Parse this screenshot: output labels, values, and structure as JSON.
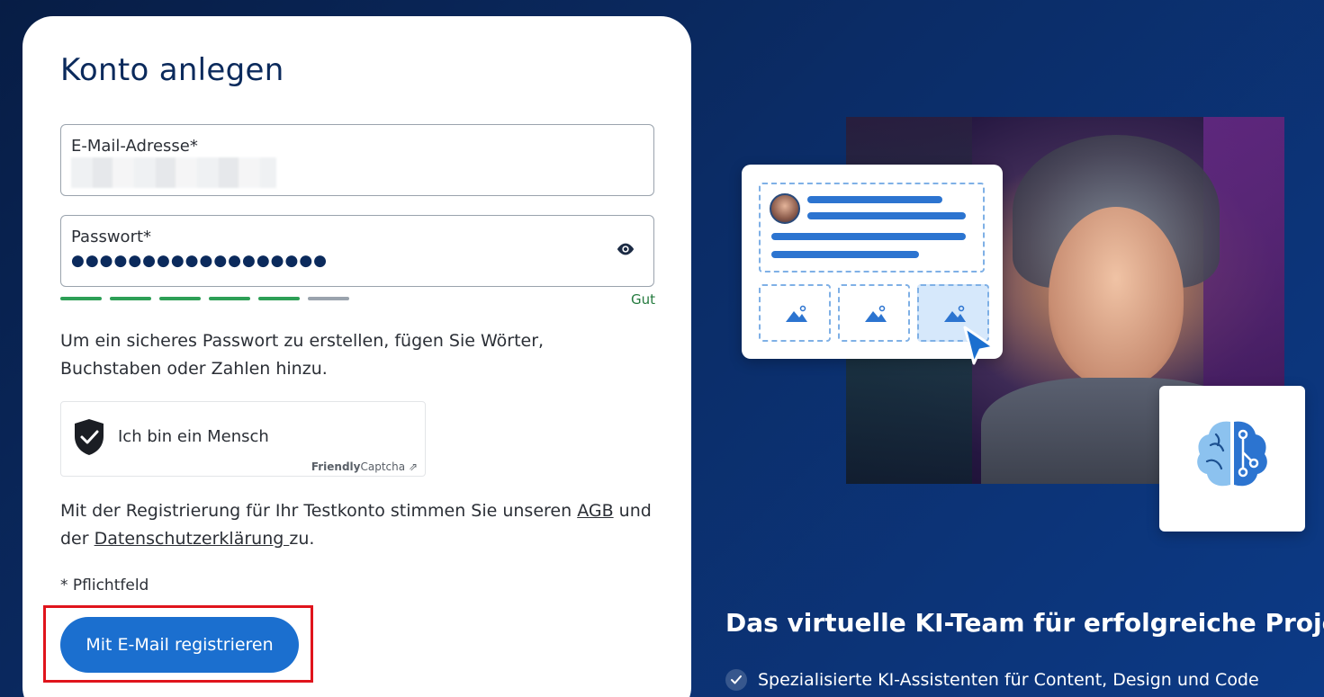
{
  "form": {
    "title": "Konto anlegen",
    "email": {
      "label": "E-Mail-Adresse*",
      "value": ""
    },
    "password": {
      "label": "Passwort*",
      "value": "●●●●●●●●●●●●●●●●●●",
      "strength_label": "Gut",
      "strength_level": 5,
      "strength_max": 6
    },
    "hint": "Um ein sicheres Passwort zu erstellen, fügen Sie Wörter, Buchstaben oder Zahlen hinzu.",
    "captcha": {
      "text": "Ich bin ein Mensch",
      "brand_bold": "Friendly",
      "brand_rest": "Captcha"
    },
    "terms": {
      "prefix": "Mit der Registrierung für Ihr Testkonto stimmen Sie unseren ",
      "agb_link": "AGB",
      "middle": " und der ",
      "privacy_link": "Datenschutzerklärung ",
      "suffix": "zu."
    },
    "required_note": "* Pflichtfeld",
    "submit_label": "Mit E-Mail registrieren"
  },
  "hero": {
    "headline": "Das virtuelle KI-Team für erfolgreiche Projekte",
    "features": [
      "Spezialisierte KI-Assistenten für Content, Design und Code"
    ]
  },
  "colors": {
    "accent": "#1b6fcf",
    "title": "#0b2a5c",
    "strength_ok": "#2d9f56",
    "highlight": "#e0141c"
  }
}
